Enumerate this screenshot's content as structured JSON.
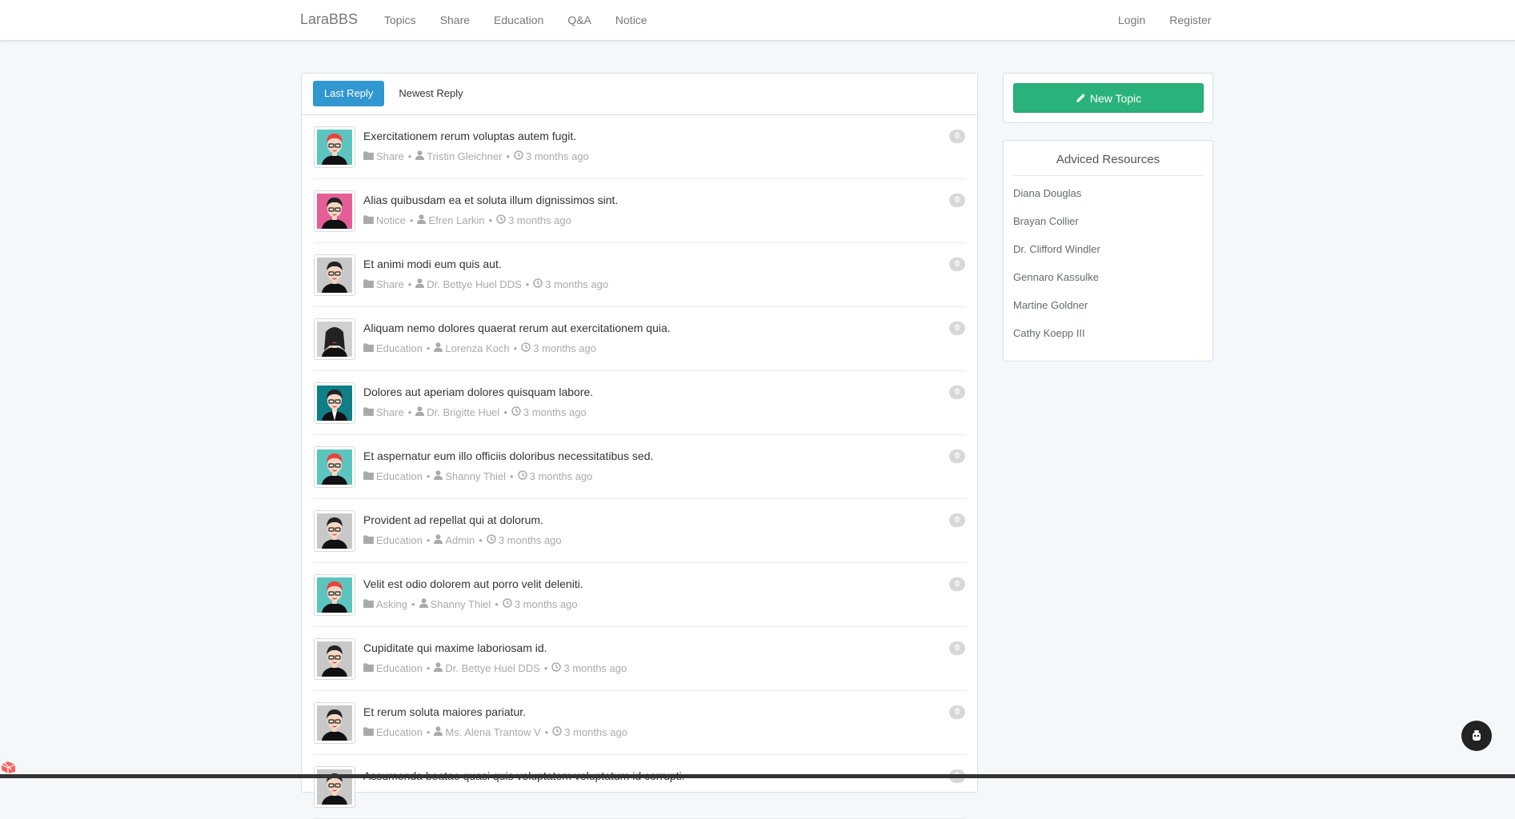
{
  "navbar": {
    "brand": "LaraBBS",
    "links": [
      {
        "label": "Topics"
      },
      {
        "label": "Share"
      },
      {
        "label": "Education"
      },
      {
        "label": "Q&A"
      },
      {
        "label": "Notice"
      }
    ],
    "right": [
      {
        "label": "Login"
      },
      {
        "label": "Register"
      }
    ]
  },
  "tabs": [
    {
      "label": "Last Reply",
      "active": true
    },
    {
      "label": "Newest Reply",
      "active": false
    }
  ],
  "topics": [
    {
      "title": "Exercitationem rerum voluptas autem fugit.",
      "category": "Share",
      "author": "Tristin Gleichner",
      "time": "3 months ago",
      "replies": "0",
      "avatar": {
        "bg": "#5ec4c0",
        "hair": "#e8433a",
        "style": "glasses"
      }
    },
    {
      "title": "Alias quibusdam ea et soluta illum dignissimos sint.",
      "category": "Notice",
      "author": "Efren Larkin",
      "time": "3 months ago",
      "replies": "0",
      "avatar": {
        "bg": "#e45f98",
        "hair": "#222222",
        "style": "glasses"
      }
    },
    {
      "title": "Et animi modi eum quis aut.",
      "category": "Share",
      "author": "Dr. Bettye Huel DDS",
      "time": "3 months ago",
      "replies": "0",
      "avatar": {
        "bg": "#c8c8c8",
        "hair": "#222222",
        "style": "glasses"
      }
    },
    {
      "title": "Aliquam nemo dolores quaerat rerum aut exercitationem quia.",
      "category": "Education",
      "author": "Lorenza Koch",
      "time": "3 months ago",
      "replies": "0",
      "avatar": {
        "bg": "#d0d0d0",
        "hair": "#222222",
        "style": "long"
      }
    },
    {
      "title": "Dolores aut aperiam dolores quisquam labore.",
      "category": "Share",
      "author": "Dr. Brigitte Huel",
      "time": "3 months ago",
      "replies": "0",
      "avatar": {
        "bg": "#0f7e86",
        "hair": "#222222",
        "style": "suit"
      }
    },
    {
      "title": "Et aspernatur eum illo officiis doloribus necessitatibus sed.",
      "category": "Education",
      "author": "Shanny Thiel",
      "time": "3 months ago",
      "replies": "0",
      "avatar": {
        "bg": "#5ec4c0",
        "hair": "#e8433a",
        "style": "glasses"
      }
    },
    {
      "title": "Provident ad repellat qui at dolorum.",
      "category": "Education",
      "author": "Admin",
      "time": "3 months ago",
      "replies": "0",
      "avatar": {
        "bg": "#c8c8c8",
        "hair": "#222222",
        "style": "glasses"
      }
    },
    {
      "title": "Velit est odio dolorem aut porro velit deleniti.",
      "category": "Asking",
      "author": "Shanny Thiel",
      "time": "3 months ago",
      "replies": "0",
      "avatar": {
        "bg": "#5ec4c0",
        "hair": "#e8433a",
        "style": "glasses"
      }
    },
    {
      "title": "Cupiditate qui maxime laboriosam id.",
      "category": "Education",
      "author": "Dr. Bettye Huel DDS",
      "time": "3 months ago",
      "replies": "0",
      "avatar": {
        "bg": "#c8c8c8",
        "hair": "#222222",
        "style": "glasses"
      }
    },
    {
      "title": "Et rerum soluta maiores pariatur.",
      "category": "Education",
      "author": "Ms. Alena Trantow V",
      "time": "3 months ago",
      "replies": "0",
      "avatar": {
        "bg": "#c8c8c8",
        "hair": "#222222",
        "style": "glasses"
      }
    },
    {
      "title": "Assumenda beatae quasi quis voluptatem voluptatum id corrupti.",
      "category": "",
      "author": "",
      "time": "",
      "replies": "0",
      "avatar": {
        "bg": "#c8c8c8",
        "hair": "#222222",
        "style": "glasses"
      }
    }
  ],
  "sidebar": {
    "new_topic_label": "New Topic",
    "resources_title": "Adviced Resources",
    "resources": [
      "Diana Douglas",
      "Brayan Collier",
      "Dr. Clifford Windler",
      "Gennaro Kassulke",
      "Martine Goldner",
      "Cathy Koepp III"
    ]
  },
  "colors": {
    "primary": "#3097d1",
    "success": "#2ab27b",
    "muted": "#aaaaaa",
    "badge": "#d8d8d8"
  },
  "icons": {
    "category": "folder-icon",
    "author": "user-icon",
    "time": "clock-icon",
    "new_topic": "pencil-icon",
    "floating": "debug-icon"
  }
}
